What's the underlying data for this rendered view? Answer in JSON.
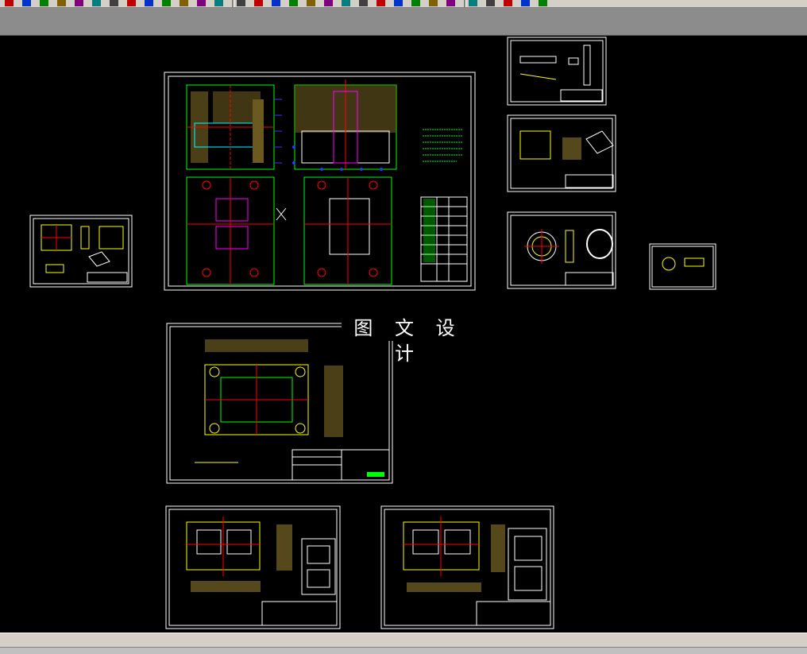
{
  "watermark": "图 文 设 计",
  "colors": {
    "canvas": "#000000",
    "chrome": "#d4d0c8",
    "line_white": "#ffffff",
    "line_green": "#00ff00",
    "line_yellow": "#ffff00",
    "line_red": "#ff0000",
    "line_cyan": "#00ffff",
    "line_blue": "#3333ff",
    "line_magenta": "#ff00ff"
  },
  "toolbar": {
    "icons": [
      "move-icon",
      "grip-icon",
      "print-icon",
      "find-icon",
      "circle-icon",
      "lines-icon",
      "pin-icon",
      "tool-icon",
      "add-icon",
      "cut-icon",
      "snap-icon",
      "clock-icon",
      "pencil-icon",
      "copy-icon",
      "table-icon",
      "layer-icon",
      "window-icon",
      "mirror-icon",
      "array-icon",
      "zoom-icon",
      "view-icon",
      "pan-icon",
      "orbit-icon",
      "render-icon",
      "dim-icon",
      "text-icon",
      "hatch-icon",
      "block-icon",
      "grid-icon",
      "flag-icon",
      "help-icon"
    ]
  },
  "drawings": [
    {
      "name": "mold-assembly-drawing"
    },
    {
      "name": "small-part-drawing-left"
    },
    {
      "name": "part-drawing-top-right-1"
    },
    {
      "name": "part-drawing-top-right-2"
    },
    {
      "name": "part-drawing-top-right-3"
    },
    {
      "name": "tiny-part-drawing"
    },
    {
      "name": "plate-drawing"
    },
    {
      "name": "cavity-drawing-left"
    },
    {
      "name": "cavity-drawing-right"
    }
  ]
}
